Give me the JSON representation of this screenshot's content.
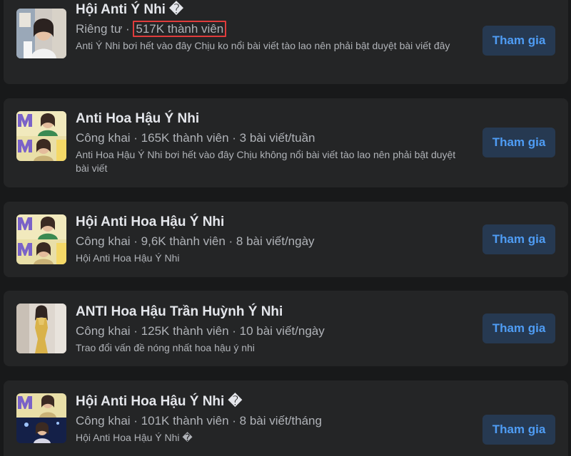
{
  "groups": [
    {
      "title": "Hội Anti Ý Nhi �",
      "meta_prefix": "Riêng tư · ",
      "meta_highlight": "517K thành viên",
      "description": "Anti Ý Nhi bơi hết vào đây Chịu ko nổi bài viết tào lao nên phải bật duyệt bài viết đây",
      "join_label": "Tham gia"
    },
    {
      "title": "Anti Hoa Hậu Ý Nhi",
      "meta": "Công khai · 165K thành viên · 3 bài viết/tuần",
      "description": "Anti Hoa Hậu Ý Nhi bơi hết vào đây Chịu không nổi bài viết tào lao nên phải bật duyệt bài viết",
      "join_label": "Tham gia"
    },
    {
      "title": "Hội Anti Hoa Hậu Ý Nhi",
      "meta": "Công khai · 9,6K thành viên · 8 bài viết/ngày",
      "description": "Hội Anti Hoa Hậu Ý Nhi",
      "join_label": "Tham gia"
    },
    {
      "title": "ANTI Hoa Hậu Trần Huỳnh Ý Nhi",
      "meta": "Công khai · 125K thành viên · 10 bài viết/ngày",
      "description": "Trao đổi vấn đề nóng nhất hoa hậu ý nhi",
      "join_label": "Tham gia"
    },
    {
      "title": "Hội Anti Hoa Hậu Ý Nhi �",
      "meta": "Công khai · 101K thành viên · 8 bài viết/tháng",
      "description": "Hội Anti Hoa Hậu Ý Nhi �",
      "join_label": "Tham gia"
    }
  ],
  "colors": {
    "page_bg": "#18191a",
    "card_bg": "#242526",
    "primary_text": "#e4e6eb",
    "secondary_text": "#b0b3b8",
    "button_bg": "#263951",
    "button_text": "#4f9df5",
    "highlight_border": "#e03c3c"
  },
  "icons": {
    "watermark": "lotus-logo-icon"
  }
}
